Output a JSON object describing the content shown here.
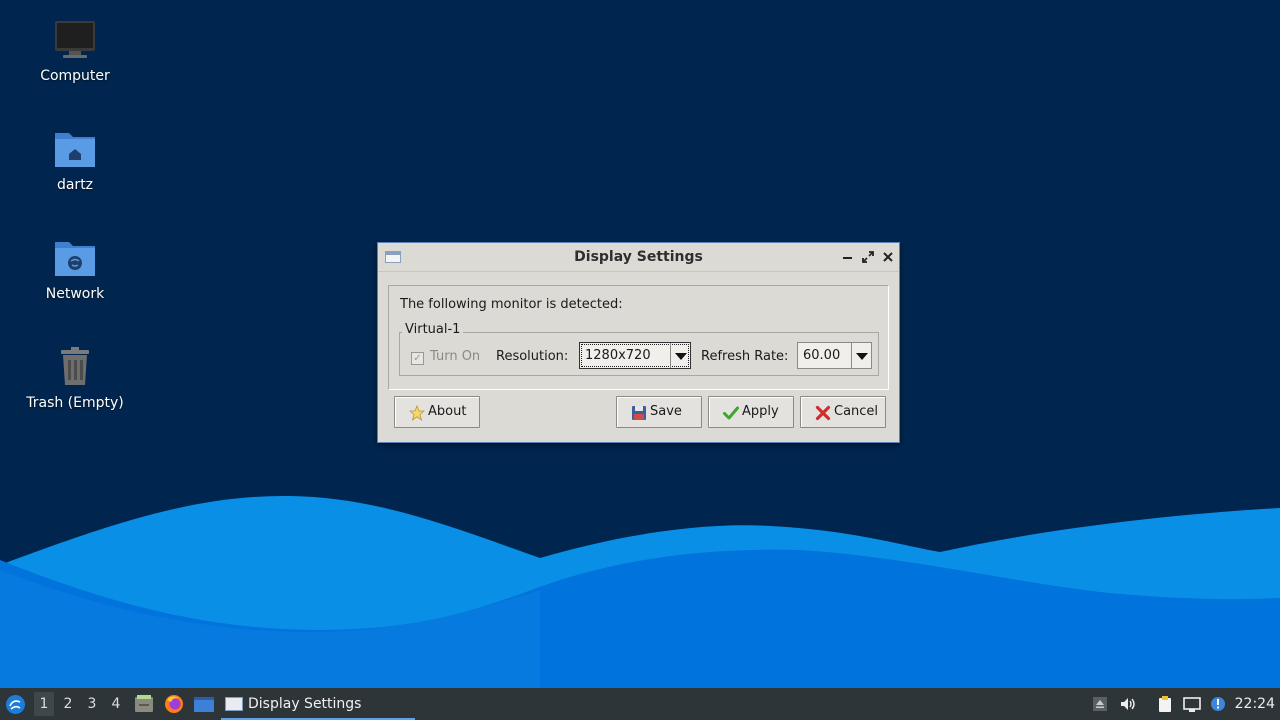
{
  "desktop": {
    "icons": [
      {
        "label": "Computer"
      },
      {
        "label": "dartz"
      },
      {
        "label": "Network"
      },
      {
        "label": "Trash (Empty)"
      }
    ]
  },
  "dialog": {
    "title": "Display Settings",
    "detected_text": "The following monitor is detected:",
    "monitor_name": "Virtual-1",
    "turn_on_label": "Turn On",
    "turn_on_checked": true,
    "resolution_label": "Resolution:",
    "resolution_value": "1280x720",
    "refresh_label": "Refresh Rate:",
    "refresh_value": "60.00",
    "buttons": {
      "about": "About",
      "save": "Save",
      "apply": "Apply",
      "cancel": "Cancel"
    }
  },
  "taskbar": {
    "workspaces": [
      "1",
      "2",
      "3",
      "4"
    ],
    "active_workspace": "1",
    "task_label": "Display Settings",
    "clock": "22:24"
  },
  "colors": {
    "desktop_bg": "#00264f",
    "accent": "#5fa0e6",
    "taskbar_bg": "#2d3539",
    "dialog_bg": "#dcdad5"
  }
}
